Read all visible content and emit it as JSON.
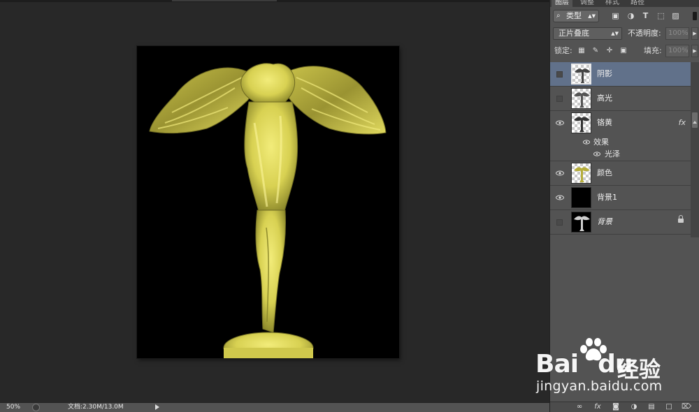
{
  "status_bar": {
    "zoom": "50%",
    "doc_info": "文档:2.30M/13.0M"
  },
  "panel": {
    "tabs": [
      {
        "label": "图层",
        "active": true
      },
      {
        "label": "调整",
        "active": false
      },
      {
        "label": "样式",
        "active": false
      },
      {
        "label": "路径",
        "active": false
      }
    ],
    "filter": {
      "kind_label": "类型",
      "icons": [
        "image-filter-icon",
        "adjustment-filter-icon",
        "type-filter-icon",
        "shape-filter-icon",
        "smart-object-filter-icon"
      ]
    },
    "blend_mode": "正片叠底",
    "opacity_label": "不透明度:",
    "opacity_value": "100%",
    "lock_label": "锁定:",
    "fill_label": "填充:",
    "fill_value": "100%",
    "layers": [
      {
        "name": "阴影",
        "visible": false,
        "selected": true
      },
      {
        "name": "高光",
        "visible": false,
        "selected": false
      },
      {
        "name": "铬黄",
        "visible": true,
        "selected": false,
        "fx": "fx"
      },
      {
        "name": "颜色",
        "visible": true,
        "selected": false
      },
      {
        "name": "背景1",
        "visible": true,
        "selected": false
      },
      {
        "name": "背景",
        "visible": false,
        "selected": false,
        "locked": true
      }
    ],
    "effects": {
      "header": "效果",
      "items": [
        "光泽"
      ]
    }
  },
  "watermark": {
    "brand": "Bai",
    "brand_tail": "du",
    "cn_text": "经验",
    "url": "jingyan.baidu.com"
  },
  "colors": {
    "canvas_bg": "#282828",
    "panel_bg": "#535353",
    "selected_layer": "#61718a",
    "statue_gold": "#e2dc5a"
  }
}
